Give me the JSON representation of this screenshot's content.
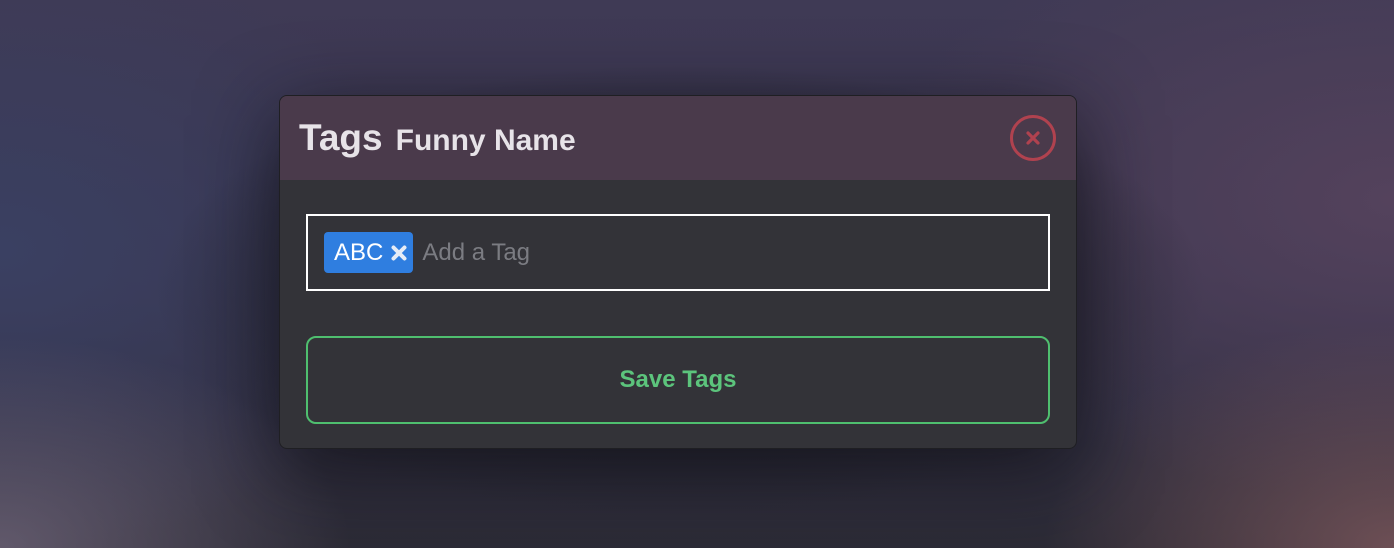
{
  "modal": {
    "title": "Tags",
    "subtitle": "Funny Name",
    "close_icon": "close-circle-icon"
  },
  "tag_input": {
    "tags": [
      {
        "label": "ABC",
        "remove_icon": "close-icon"
      }
    ],
    "placeholder": "Add a Tag",
    "value": ""
  },
  "actions": {
    "save_label": "Save Tags"
  },
  "colors": {
    "header_bg": "#4a3a4b",
    "modal_bg": "#333338",
    "close_red": "#b0424f",
    "tag_blue": "#2f7ee0",
    "save_green": "#5cc47c"
  }
}
